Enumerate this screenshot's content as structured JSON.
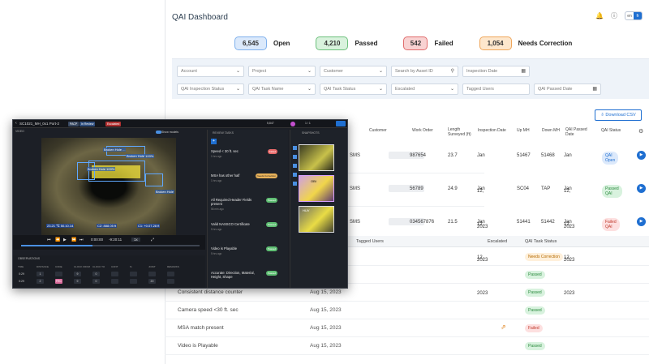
{
  "dashboard": {
    "title": "QAI Dashboard",
    "lang": {
      "left": "en",
      "right": "fr"
    },
    "stats": [
      {
        "count": "6,545",
        "label": "Open",
        "bg": "#dbe9fb",
        "border": "#7fb0ec"
      },
      {
        "count": "4,210",
        "label": "Passed",
        "bg": "#d9f2dd",
        "border": "#6cc07c"
      },
      {
        "count": "542",
        "label": "Failed",
        "bg": "#f8d2d2",
        "border": "#e06b6b"
      },
      {
        "count": "1,054",
        "label": "Needs Correction",
        "bg": "#fde7cd",
        "border": "#efa65a"
      }
    ],
    "filters": {
      "account": "Account",
      "project": "Project",
      "customer": "Customer",
      "search_asset": "Search by Asset ID",
      "inspection_date": "Inspection Date",
      "qai_status": "QAI Inspection Status",
      "qai_task_name": "QAI Task Name",
      "qai_task_status": "QAI Task Status",
      "escalated": "Escalated",
      "tagged_users": "Tagged Users",
      "qai_passed_date": "QAI Passed Date"
    },
    "download_label": "Download CSV",
    "table_headers": {
      "customer": "Customer",
      "work_order": "Work Order",
      "length": "Length Surveyed (ft)",
      "inspection_date": "Inspection Date",
      "up_mh": "Up MH",
      "down_mh": "Down MH",
      "qai_passed": "QAI Passed Date",
      "qai_status": "QAI Status"
    },
    "rows": [
      {
        "customer_suffix": "SMS",
        "work_order": "987654",
        "length": "23.7",
        "inspection_date": "Jan 12, 2023",
        "up_mh": "51467",
        "down_mh": "51468",
        "qai_passed": "Jan 12, 2023",
        "status": "QAI Open"
      },
      {
        "customer_suffix": "SMS",
        "work_order": "56789",
        "length": "24.9",
        "inspection_date": "Jan 12, 2023",
        "up_mh": "SC04",
        "down_mh": "TAP",
        "qai_passed": "Jan 12, 2023",
        "status": "Passed QAI"
      },
      {
        "customer_suffix": "SMS",
        "work_order": "034567876",
        "length": "21.5",
        "inspection_date": "Jan 12, 2023",
        "up_mh": "51441",
        "down_mh": "51442",
        "qai_passed": "Jan 12, 2023",
        "status": "Failed QAI"
      }
    ],
    "sub_headers": {
      "tagged": "Tagged Users",
      "escalated": "Escalated",
      "task_status": "QAI Task Status"
    },
    "sub_rows": [
      {
        "task": "",
        "date": "",
        "status": "Needs Correction"
      },
      {
        "task": "",
        "date": "",
        "status": "Passed"
      },
      {
        "task": "Consistent distance counter",
        "date": "Aug 15, 2023",
        "status": "Passed"
      },
      {
        "task": "Camera speed <30 ft. sec",
        "date": "Aug 15, 2023",
        "status": "Passed"
      },
      {
        "task": "MSA match present",
        "date": "Aug 15, 2023",
        "status": "Failed"
      },
      {
        "task": "Video is Playable",
        "date": "Aug 15, 2023",
        "status": "Passed"
      }
    ]
  },
  "viewer": {
    "title": "SC1021_MH_0x1 Port-2",
    "tags": [
      "PACP",
      "In Review",
      "Escalated"
    ],
    "video_label": "VIDEO",
    "show_models": "Show models",
    "review_label": "REVIEW TASKS",
    "snapshots_label": "SNAPSHOTS",
    "pager": "1 / 1",
    "count": "5,847",
    "time": "0:00:00",
    "time_total": "-9:20:11",
    "speed": "1x",
    "overlay_left": "23.21  ℃ 50.10.14",
    "overlay_mid": "CZ: 888.05 ft",
    "overlay_right": "C1: +0.07.28 ft",
    "ann_labels": [
      "Broken Hole ...",
      "Broken Hole 100%",
      "Broken Hole 100%",
      "Broken Hole"
    ],
    "observations_label": "OBSERVATIONS",
    "obs_headers": [
      "TIME",
      "DISTANCE",
      "CODE",
      "CLOCK FROM",
      "CLOCK TO",
      "CONT",
      "%",
      "JOINT",
      "REMARKS"
    ],
    "obs_rows": [
      [
        "0:29",
        "1",
        "",
        "9",
        "0",
        "",
        "",
        "",
        ""
      ],
      [
        "0:29",
        "2",
        "FRC",
        "9",
        "0",
        "",
        "",
        "20",
        ""
      ]
    ],
    "tasks": [
      {
        "title": "Speed < 30 ft. sec",
        "meta": "1 hrs ago",
        "badge": "Failed",
        "kind": "fail"
      },
      {
        "title": "MSA has other half",
        "meta": "1 hrs ago",
        "badge": "Needs Correction",
        "kind": "need"
      },
      {
        "title": "All Required Header Fields present",
        "meta": "56 min ago",
        "badge": "Passed",
        "kind": "pass"
      },
      {
        "title": "Valid NASSCO Certificate",
        "meta": "5 hrs ago",
        "badge": "Passed",
        "kind": "pass"
      },
      {
        "title": "Video is Playable",
        "meta": "5 hrs ago",
        "badge": "Passed",
        "kind": "pass"
      },
      {
        "title": "Accurate: Direction, Material, Height, Shape",
        "meta": "",
        "badge": "Passed",
        "kind": "pass"
      }
    ],
    "snap_labels": [
      "",
      "OBI",
      "HUV"
    ]
  }
}
